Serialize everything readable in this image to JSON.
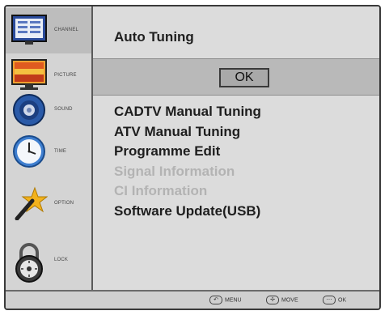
{
  "sidebar": {
    "items": [
      {
        "label": "CHANNEL",
        "icon": "channel-icon"
      },
      {
        "label": "PICTURE",
        "icon": "picture-icon"
      },
      {
        "label": "SOUND",
        "icon": "sound-icon"
      },
      {
        "label": "TIME",
        "icon": "clock-icon"
      },
      {
        "label": "OPTION",
        "icon": "option-icon"
      },
      {
        "label": "LOCK",
        "icon": "lock-icon"
      }
    ]
  },
  "main": {
    "title": "Auto Tuning",
    "ok_label": "OK",
    "menu": [
      {
        "label": "CADTV Manual Tuning",
        "enabled": true
      },
      {
        "label": "ATV Manual Tuning",
        "enabled": true
      },
      {
        "label": "Programme Edit",
        "enabled": true
      },
      {
        "label": "Signal Information",
        "enabled": false
      },
      {
        "label": "CI Information",
        "enabled": false
      },
      {
        "label": "Software Update(USB)",
        "enabled": true
      }
    ]
  },
  "footer": {
    "menu": "MENU",
    "move": "MOVE",
    "ok": "OK"
  }
}
